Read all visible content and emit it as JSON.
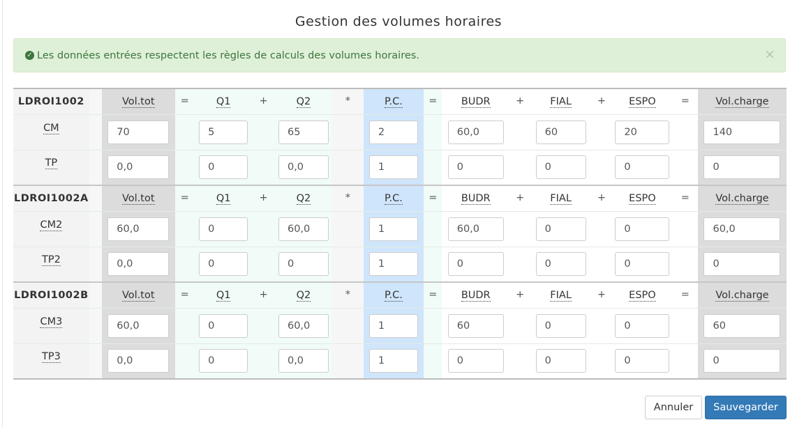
{
  "title": "Gestion des volumes horaires",
  "alert": {
    "message": "Les données entrées respectent les règles de calculs des volumes horaires.",
    "icon": "check-circle-icon",
    "close": "×"
  },
  "headers": {
    "vol_tot": "Vol.tot",
    "q1": "Q1",
    "q2": "Q2",
    "pc": "P.C.",
    "budr": "BUDR",
    "fial": "FIAL",
    "espo": "ESPO",
    "vol_charge": "Vol.charge"
  },
  "operators": {
    "eq": "=",
    "plus": "+",
    "mul": "*"
  },
  "groups": [
    {
      "code": "LDROI1002",
      "rows": [
        {
          "label": "CM",
          "vol_tot": "70",
          "q1": "5",
          "q2": "65",
          "pc": "2",
          "budr": "60,0",
          "fial": "60",
          "espo": "20",
          "vol_charge": "140"
        },
        {
          "label": "TP",
          "vol_tot": "0,0",
          "q1": "0",
          "q2": "0,0",
          "pc": "1",
          "budr": "0",
          "fial": "0",
          "espo": "0",
          "vol_charge": "0"
        }
      ]
    },
    {
      "code": "LDROI1002A",
      "rows": [
        {
          "label": "CM2",
          "vol_tot": "60,0",
          "q1": "0",
          "q2": "60,0",
          "pc": "1",
          "budr": "60,0",
          "fial": "0",
          "espo": "0",
          "vol_charge": "60,0"
        },
        {
          "label": "TP2",
          "vol_tot": "0,0",
          "q1": "0",
          "q2": "0",
          "pc": "1",
          "budr": "0",
          "fial": "0",
          "espo": "0",
          "vol_charge": "0"
        }
      ]
    },
    {
      "code": "LDROI1002B",
      "rows": [
        {
          "label": "CM3",
          "vol_tot": "60,0",
          "q1": "0",
          "q2": "60,0",
          "pc": "1",
          "budr": "60",
          "fial": "0",
          "espo": "0",
          "vol_charge": "60"
        },
        {
          "label": "TP3",
          "vol_tot": "0,0",
          "q1": "0",
          "q2": "0,0",
          "pc": "1",
          "budr": "0",
          "fial": "0",
          "espo": "0",
          "vol_charge": "0"
        }
      ]
    }
  ],
  "buttons": {
    "cancel": "Annuler",
    "save": "Sauvegarder"
  },
  "colors": {
    "success_bg": "#dff0d8",
    "success_text": "#3c763d",
    "primary": "#337ab7",
    "pc_column": "#cfe5fb"
  }
}
